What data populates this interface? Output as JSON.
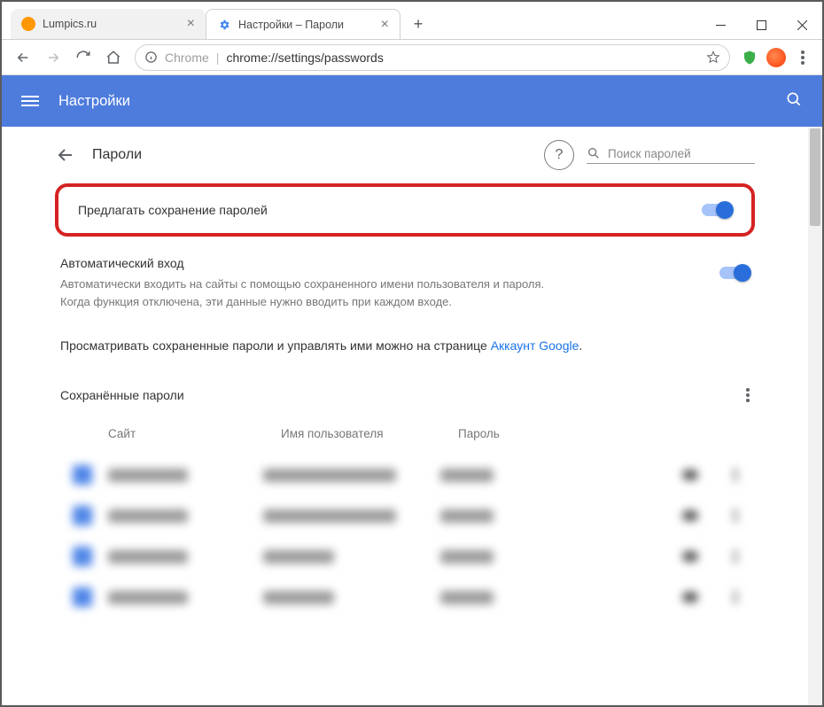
{
  "window": {
    "tabs": [
      {
        "title": "Lumpics.ru",
        "active": false,
        "favicon": "#ff9800"
      },
      {
        "title": "Настройки – Пароли",
        "active": true,
        "favicon": "#4285f4"
      }
    ]
  },
  "toolbar": {
    "chrome_label": "Chrome",
    "url": "chrome://settings/passwords"
  },
  "blue_header": {
    "title": "Настройки"
  },
  "page": {
    "back_title": "Пароли",
    "search_placeholder": "Поиск паролей",
    "offer_save": {
      "label": "Предлагать сохранение паролей",
      "on": true
    },
    "auto_signin": {
      "title": "Автоматический вход",
      "desc": "Автоматически входить на сайты с помощью сохраненного имени пользователя и пароля. Когда функция отключена, эти данные нужно вводить при каждом входе.",
      "on": true
    },
    "manage_text": "Просматривать сохраненные пароли и управлять ими можно на странице ",
    "manage_link": "Аккаунт Google",
    "saved_title": "Сохранённые пароли",
    "columns": {
      "site": "Сайт",
      "user": "Имя пользователя",
      "pass": "Пароль"
    }
  }
}
